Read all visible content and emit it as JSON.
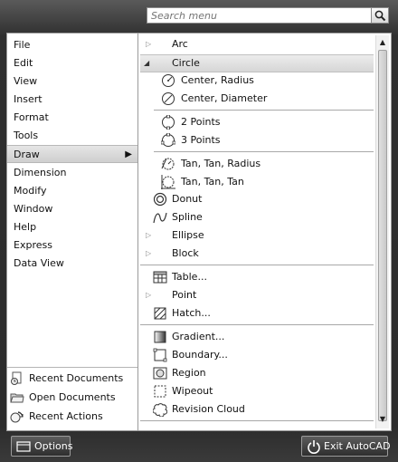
{
  "search": {
    "placeholder": "Search menu"
  },
  "menu": {
    "items": [
      {
        "label": "File"
      },
      {
        "label": "Edit"
      },
      {
        "label": "View"
      },
      {
        "label": "Insert"
      },
      {
        "label": "Format"
      },
      {
        "label": "Tools"
      },
      {
        "label": "Draw",
        "arrow": "▶"
      },
      {
        "label": "Dimension"
      },
      {
        "label": "Modify"
      },
      {
        "label": "Window"
      },
      {
        "label": "Help"
      },
      {
        "label": "Express"
      },
      {
        "label": "Data View"
      }
    ]
  },
  "documents": {
    "recent_documents": "Recent Documents",
    "open_documents": "Open Documents",
    "recent_actions": "Recent Actions"
  },
  "submenu": {
    "expanded_triangle": "◢",
    "collapsed_triangle": "▷",
    "arc": "Arc",
    "circle": "Circle",
    "center_radius": "Center, Radius",
    "center_diameter": "Center, Diameter",
    "two_points": "2 Points",
    "three_points": "3 Points",
    "tan_tan_radius": "Tan, Tan, Radius",
    "tan_tan_tan": "Tan, Tan, Tan",
    "donut": "Donut",
    "spline": "Spline",
    "ellipse": "Ellipse",
    "block": "Block",
    "table": "Table...",
    "point": "Point",
    "hatch": "Hatch...",
    "gradient": "Gradient...",
    "boundary": "Boundary...",
    "region": "Region",
    "wipeout": "Wipeout",
    "revision_cloud": "Revision Cloud"
  },
  "scrollbar": {
    "up": "▲",
    "down": "▼"
  },
  "footer": {
    "options": "Options",
    "exit": "Exit AutoCAD"
  }
}
